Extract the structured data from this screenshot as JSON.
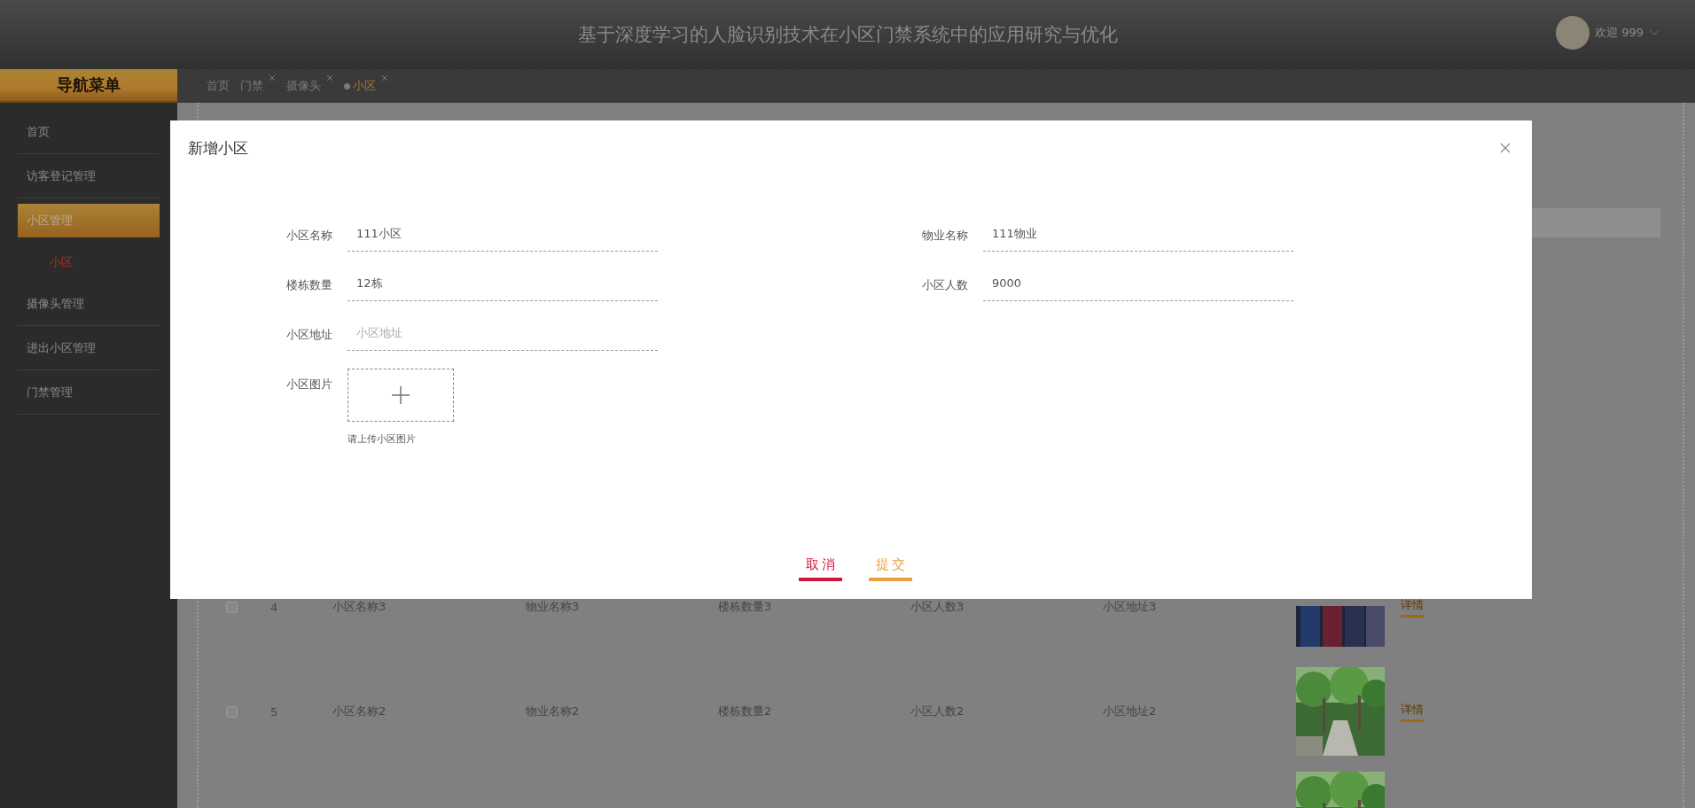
{
  "header": {
    "title": "基于深度学习的人脸识别技术在小区门禁系统中的应用研究与优化",
    "user": "欢迎 999"
  },
  "sidebar": {
    "title": "导航菜单",
    "items": [
      {
        "label": "首页",
        "selected": false
      },
      {
        "label": "访客登记管理",
        "selected": false
      },
      {
        "label": "小区管理",
        "selected": true,
        "children": [
          {
            "label": "小区",
            "selected": true
          }
        ]
      },
      {
        "label": "摄像头管理",
        "selected": false
      },
      {
        "label": "进出小区管理",
        "selected": false
      },
      {
        "label": "门禁管理",
        "selected": false
      }
    ]
  },
  "tabs": [
    {
      "label": "首页",
      "closable": false,
      "selected": false
    },
    {
      "label": "门禁",
      "closable": true,
      "selected": false
    },
    {
      "label": "摄像头",
      "closable": true,
      "selected": false
    },
    {
      "label": "小区",
      "closable": true,
      "selected": true
    }
  ],
  "table": {
    "rows": [
      {
        "checked": false,
        "index": "4",
        "cells": [
          "小区名称3",
          "物业名称3",
          "楼栋数量3",
          "小区人数3",
          "小区地址3"
        ],
        "image": {
          "kind": "picture"
        },
        "action": "详情"
      },
      {
        "checked": false,
        "index": "5",
        "cells": [
          "小区名称2",
          "物业名称2",
          "楼栋数量2",
          "小区人数2",
          "小区地址2"
        ],
        "image": {
          "kind": "picture"
        },
        "action": "详情"
      },
      {
        "image": {
          "kind": "picture"
        }
      }
    ]
  },
  "modal": {
    "title": "新增小区",
    "rows": [
      {
        "fields": [
          {
            "kind": "text",
            "label": "小区名称",
            "value": "111小区"
          },
          {
            "kind": "text",
            "label": "物业名称",
            "value": "111物业"
          }
        ]
      },
      {
        "fields": [
          {
            "kind": "text",
            "label": "楼栋数量",
            "value": "12栋"
          },
          {
            "kind": "text",
            "label": "小区人数",
            "value": "9000"
          }
        ]
      },
      {
        "fields": [
          {
            "kind": "text",
            "label": "小区地址",
            "placeholder": "小区地址"
          }
        ]
      },
      {
        "fields": [
          {
            "kind": "upload",
            "label": "小区图片",
            "hint": "请上传小区图片"
          }
        ]
      }
    ],
    "buttons": [
      {
        "label": "取消",
        "color": "#d0183c"
      },
      {
        "label": "提交",
        "color": "#e6a23c"
      }
    ]
  }
}
